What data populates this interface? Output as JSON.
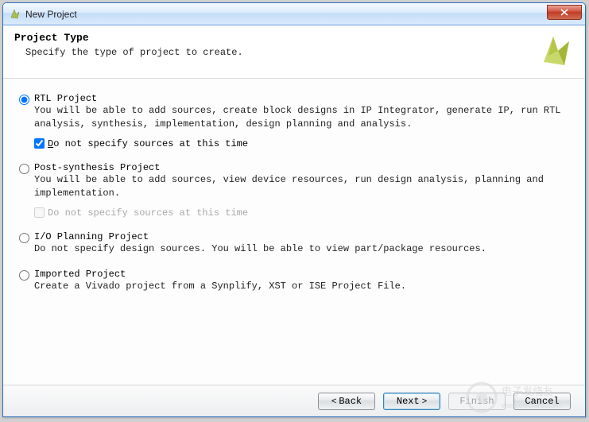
{
  "window": {
    "title": "New Project"
  },
  "header": {
    "title": "Project Type",
    "subtitle": "Specify the type of project to create."
  },
  "options": {
    "rtl": {
      "label": "RTL Project",
      "desc": "You will be able to add sources, create block designs in IP Integrator, generate IP, run RTL analysis, synthesis, implementation, design planning and analysis.",
      "checked": true,
      "checkbox_label": "Do not specify sources at this time",
      "checkbox_checked": true
    },
    "post": {
      "label": "Post-synthesis Project",
      "desc": "You will be able to add sources, view device resources, run design analysis, planning and implementation.",
      "checked": false,
      "checkbox_label": "Do not specify sources at this time",
      "checkbox_checked": false,
      "checkbox_disabled": true
    },
    "io": {
      "label": "I/O Planning Project",
      "desc": "Do not specify design sources. You will be able to view part/package resources.",
      "checked": false
    },
    "imported": {
      "label": "Imported Project",
      "desc": "Create a Vivado project from a Synplify, XST or ISE Project File.",
      "checked": false
    }
  },
  "buttons": {
    "back": "Back",
    "next": "Next",
    "finish": "Finish",
    "cancel": "Cancel"
  },
  "watermark": "电子发烧友 www.elecfans.com"
}
